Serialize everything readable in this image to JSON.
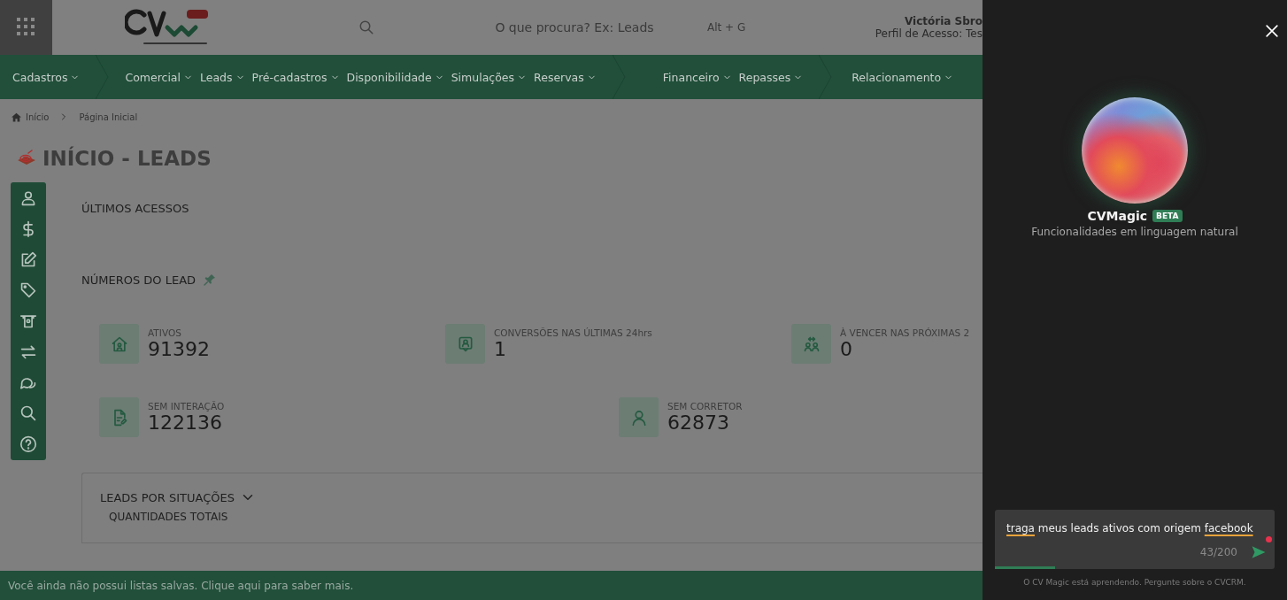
{
  "header": {
    "search_placeholder": "O que procura? Ex: Leads",
    "shortcut": "Alt + G",
    "user_name": "Victória Sbro",
    "user_profile": "Perfil de Acesso: Tes"
  },
  "nav": [
    [
      {
        "label": "Cadastros"
      }
    ],
    [
      {
        "label": "Comercial"
      },
      {
        "label": "Leads"
      },
      {
        "label": "Pré-cadastros"
      },
      {
        "label": "Disponibilidade"
      },
      {
        "label": "Simulações"
      },
      {
        "label": "Reservas"
      }
    ],
    [
      {
        "label": "Financeiro"
      },
      {
        "label": "Repasses"
      }
    ],
    [
      {
        "label": "Relacionamento"
      }
    ]
  ],
  "breadcrumb": [
    "Início",
    "Página Inicial"
  ],
  "page_title": "INÍCIO - LEADS",
  "sidebar": [
    {
      "kind": "person"
    },
    {
      "kind": "dollar"
    },
    {
      "kind": "edit"
    },
    {
      "kind": "tag"
    },
    {
      "kind": "atm"
    },
    {
      "kind": "transfer"
    },
    {
      "kind": "chat"
    },
    {
      "kind": "search"
    },
    {
      "kind": "help"
    }
  ],
  "sections": {
    "recent": "ÚLTIMOS ACESSOS",
    "numbers": "NÚMEROS DO LEAD"
  },
  "stats": [
    [
      {
        "kind": "home",
        "label": "ATIVOS",
        "value": "91392"
      },
      {
        "kind": "badge",
        "label": "CONVERSÕES NAS ÚLTIMAS 24hrs",
        "value": "1"
      },
      {
        "kind": "swap",
        "label": "À VENCER NAS PRÓXIMAS 2",
        "value": "0"
      }
    ],
    [
      {
        "kind": "doc",
        "label": "SEM INTERAÇÃO",
        "value": "122136"
      },
      {
        "kind": "user",
        "label": "SEM CORRETOR",
        "value": "62873"
      }
    ]
  ],
  "situations": {
    "title": "LEADS POR SITUAÇÕES",
    "expanded": true,
    "subtitle": "QUANTIDADES TOTAIS"
  },
  "bottom_bar": "Você ainda não possui listas salvas. Clique aqui para saber mais.",
  "panel": {
    "title": "CVMagic",
    "badge": "BETA",
    "subtitle": "Funcionalidades em linguagem natural",
    "input": [
      {
        "text": "traga",
        "flagged": true
      },
      {
        "text": "meus leads ativos com origem",
        "flagged": false
      },
      {
        "text": "facebook",
        "flagged": true
      }
    ],
    "counter": "43/200",
    "level": 0.215,
    "notification": true,
    "note": "O CV Magic está aprendendo. Pergunte sobre o CVCRM."
  }
}
